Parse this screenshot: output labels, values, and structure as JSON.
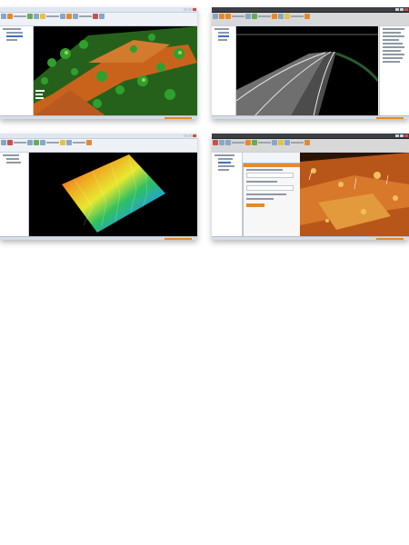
{
  "screenshots": [
    {
      "id": "shot1",
      "title": "",
      "theme": "light",
      "view": "terrain-city"
    },
    {
      "id": "shot2",
      "title": "",
      "theme": "dark",
      "view": "road-night"
    },
    {
      "id": "shot3",
      "title": "",
      "theme": "light",
      "view": "elevation-surface"
    },
    {
      "id": "shot4",
      "title": "",
      "theme": "dark",
      "view": "point-cloud-orange"
    }
  ],
  "colors": {
    "accent": "#e58a2c",
    "ribbon_blue": "#8aa6c7",
    "vegetation": "#2a8a2e",
    "terrain": "#c9631c"
  }
}
